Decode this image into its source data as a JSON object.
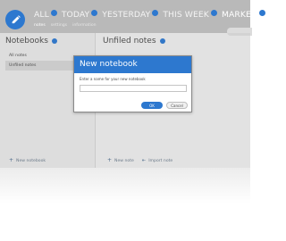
{
  "header": {
    "filters": [
      {
        "label": "ALL",
        "active": false
      },
      {
        "label": "TODAY",
        "active": false
      },
      {
        "label": "YESTERDAY",
        "active": false
      },
      {
        "label": "THIS WEEK",
        "active": false
      },
      {
        "label": "MARKED",
        "active": true
      }
    ],
    "subtabs": [
      "notes",
      "settings",
      "information"
    ]
  },
  "sidebar": {
    "title": "Notebooks",
    "items": [
      {
        "label": "All notes",
        "selected": false
      },
      {
        "label": "Unfiled notes",
        "selected": true
      }
    ],
    "new_notebook": "New notebook"
  },
  "main": {
    "title": "Unfiled notes",
    "new_note": "New note",
    "import_note": "Import note"
  },
  "dialog": {
    "title": "New notebook",
    "prompt": "Enter a name for your new notebook",
    "input_value": "",
    "ok_label": "OK",
    "cancel_label": "Cancel"
  },
  "colors": {
    "accent": "#2d78cf",
    "header_bg": "#b9b9b9",
    "sidebar_bg": "#e7e7e7",
    "selected_bg": "#d3d3d3"
  },
  "icons": [
    "pencil-icon",
    "info-icon",
    "plus-icon",
    "import-icon"
  ]
}
